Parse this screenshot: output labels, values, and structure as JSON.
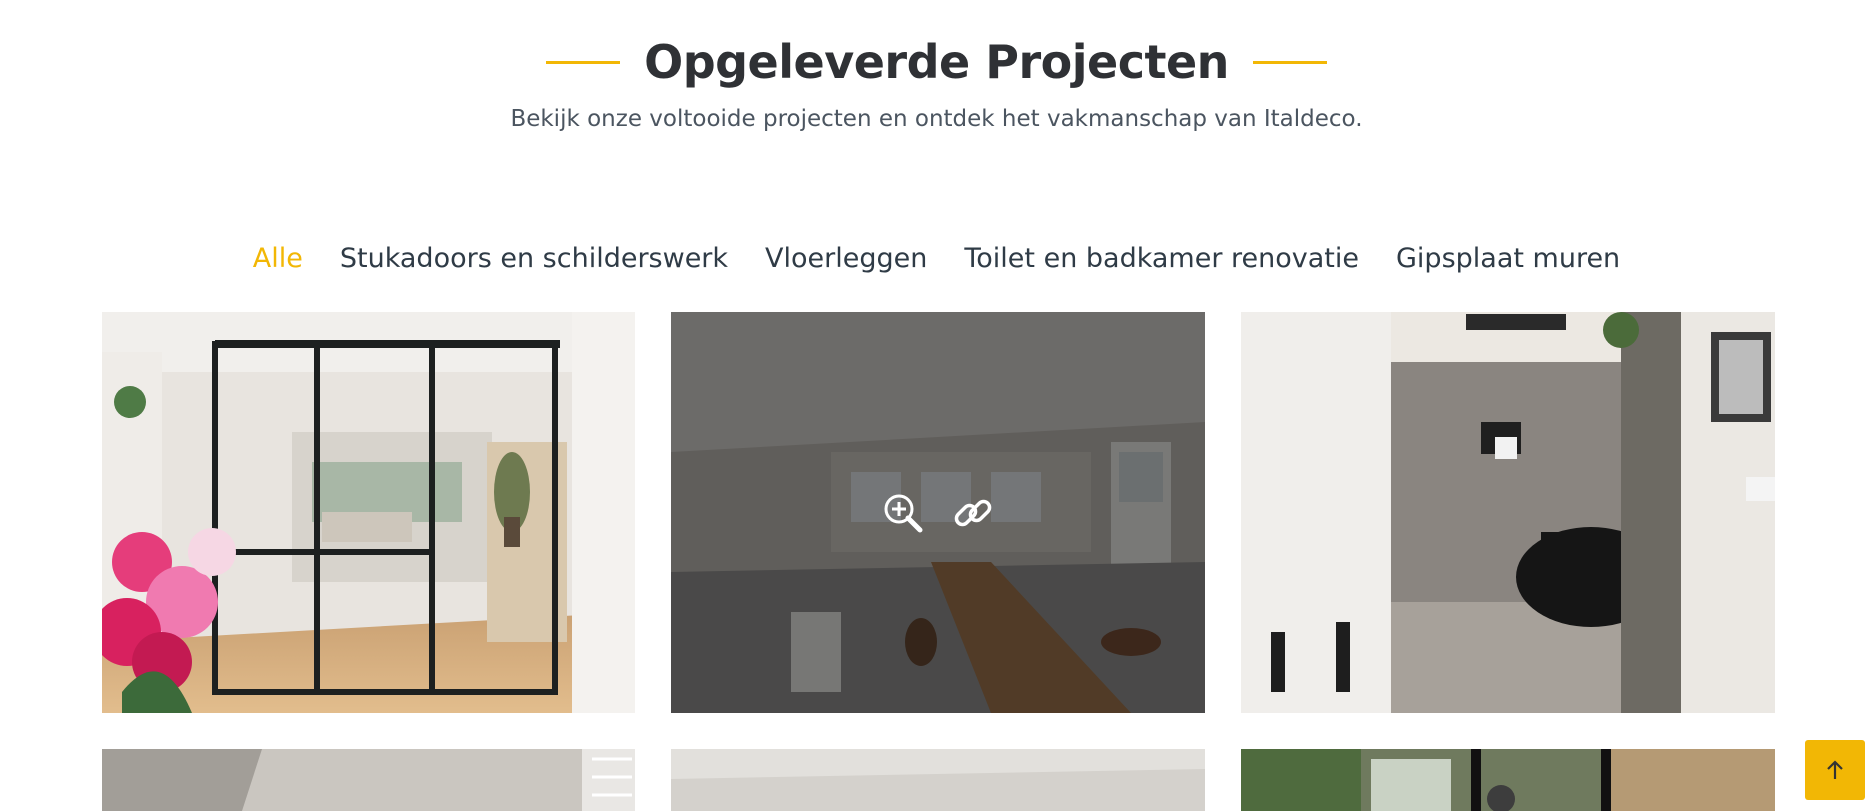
{
  "header": {
    "title": "Opgeleverde Projecten",
    "subtitle": "Bekijk onze voltooide projecten en ontdek het vakmanschap van Italdeco."
  },
  "filters": [
    {
      "label": "Alle",
      "active": true
    },
    {
      "label": "Stukadoors en schilderswerk",
      "active": false
    },
    {
      "label": "Vloerleggen",
      "active": false
    },
    {
      "label": "Toilet en badkamer renovatie",
      "active": false
    },
    {
      "label": "Gipsplaat muren",
      "active": false
    }
  ],
  "colors": {
    "accent": "#f2b705",
    "heading": "#2f3135",
    "text": "#4b5560"
  },
  "gallery_icons": [
    "zoom-in-icon",
    "link-icon"
  ],
  "scroll_top_icon": "arrow-up-icon"
}
